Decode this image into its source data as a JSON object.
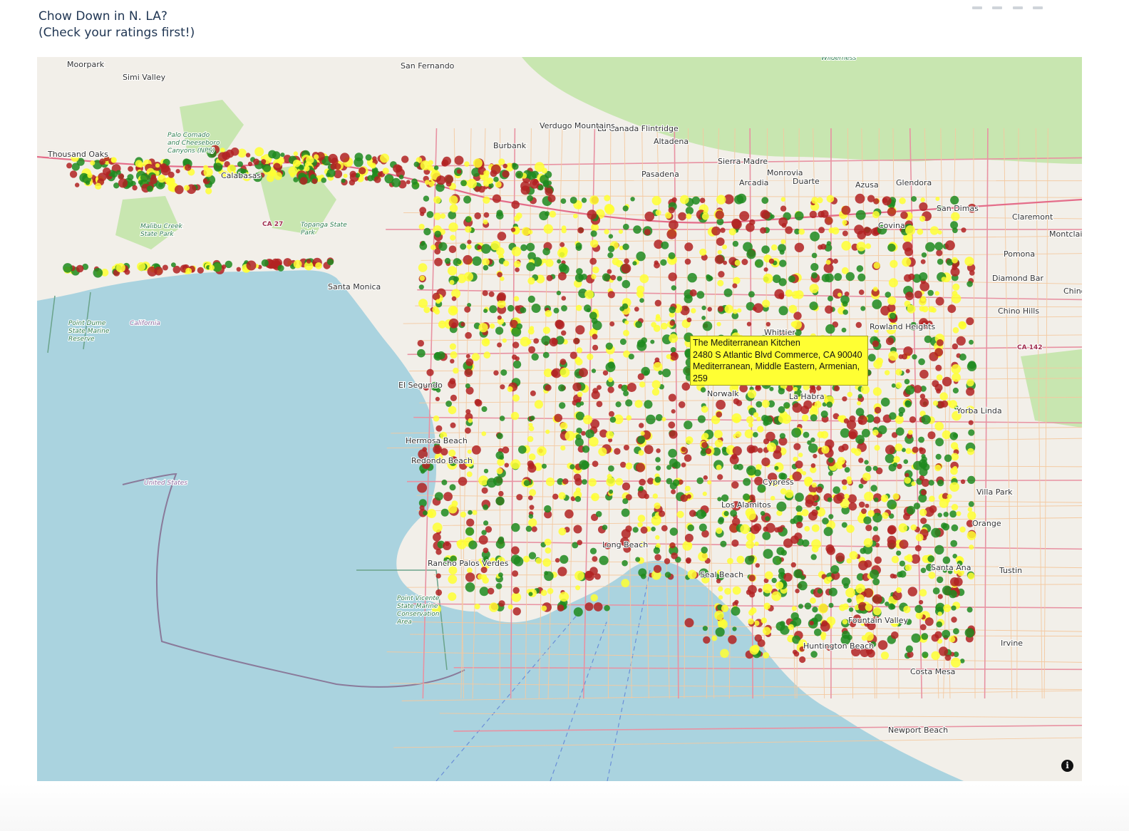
{
  "title": {
    "line1": "Chow Down in N. LA?",
    "line2": "(Check your ratings first!)"
  },
  "tooltip": {
    "name": "The Mediterranean Kitchen",
    "address": "2480 S Atlantic Blvd Commerce, CA 90040",
    "cuisine": "Mediterranean, Middle Eastern, Armenian,",
    "rating_count": "259",
    "background_color": "#ffff33"
  },
  "map": {
    "ocean_color": "#aad3df",
    "land_color": "#f2efe9",
    "park_color": "#c8e6b0",
    "marker_colors": {
      "high": "#1e8a1e",
      "mid": "#ffff33",
      "low": "#b22222"
    },
    "labels": {
      "places": [
        "Moorpark",
        "Simi Valley",
        "Thousand Oaks",
        "Calabasas",
        "Pasadena",
        "Altadena",
        "Sierra Madre",
        "Monrovia",
        "Duarte",
        "Arcadia",
        "Azusa",
        "Glendora",
        "San Dimas",
        "Claremont",
        "Covina",
        "Pomona",
        "Montclair",
        "Diamond Bar",
        "Chino Hills",
        "Rowland Heights",
        "Chino",
        "Yorba Linda",
        "Villa Park",
        "Orange",
        "Santa Ana",
        "Tustin",
        "Irvine",
        "Costa Mesa",
        "Newport Beach",
        "Huntington Beach",
        "Fountain Valley",
        "Rancho Palos Verdes",
        "Redondo Beach",
        "Hermosa Beach",
        "El Segundo",
        "Norwalk",
        "La Canada Flintridge",
        "Verdugo Mountains",
        "San Fernando",
        "Burbank",
        "Cypress",
        "Los Alamitos",
        "Long Beach",
        "Seal Beach",
        "Santa Monica",
        "La Habra",
        "Whittier"
      ],
      "areas": [
        "Point Dume State Marine Reserve",
        "Point Vicente State Marine Conservation Area",
        "Malibu Creek State Park",
        "Topanga State Park",
        "Palo Comado and Cheeseboro Canyons (NPS)",
        "Wilderness"
      ],
      "coast_labels": [
        "California",
        "United States"
      ],
      "highways": [
        "CA 142",
        "CA 27"
      ]
    }
  },
  "controls": {
    "info_icon": "i"
  }
}
